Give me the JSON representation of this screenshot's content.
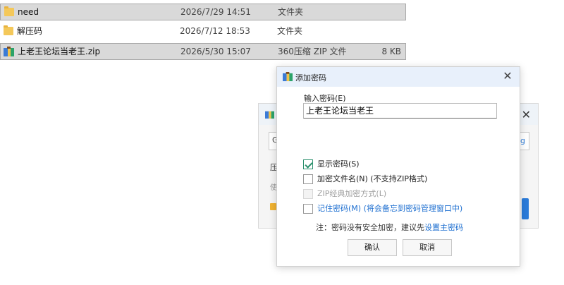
{
  "files": [
    {
      "name": "need",
      "date": "2026/7/29 14:51",
      "type": "文件夹",
      "size": "",
      "icon": "folder-icon",
      "selected": true
    },
    {
      "name": "解压码",
      "date": "2026/7/12 18:53",
      "type": "文件夹",
      "size": "",
      "icon": "folder-icon",
      "selected": false
    },
    {
      "name": "上老王论坛当老王.zip",
      "date": "2026/5/30 15:07",
      "type": "360压缩 ZIP 文件",
      "size": "8 KB",
      "icon": "zip-icon",
      "selected": true
    }
  ],
  "back_dialog": {
    "input_prefix": "G",
    "input_suffix": "lg",
    "line1": "压",
    "line2": "使"
  },
  "dialog": {
    "title": "添加密码",
    "password_label": "输入密码(E)",
    "password_value": "上老王论坛当老王",
    "options": {
      "show_password": "显示密码(S)",
      "encrypt_filenames": "加密文件名(N) (不支持ZIP格式)",
      "zip_classic": "ZIP经典加密方式(L)",
      "remember_password": "记住密码(M) (将会备忘到密码管理窗口中)"
    },
    "note_prefix": "注：密码没有安全加密，建议先",
    "note_link": "设置主密码",
    "ok_label": "确认",
    "cancel_label": "取消"
  },
  "colors": {
    "accent": "#1e6fd0",
    "selected_row": "#d9d9d9",
    "folder": "#f4c85a",
    "check": "#2a8f6c"
  }
}
